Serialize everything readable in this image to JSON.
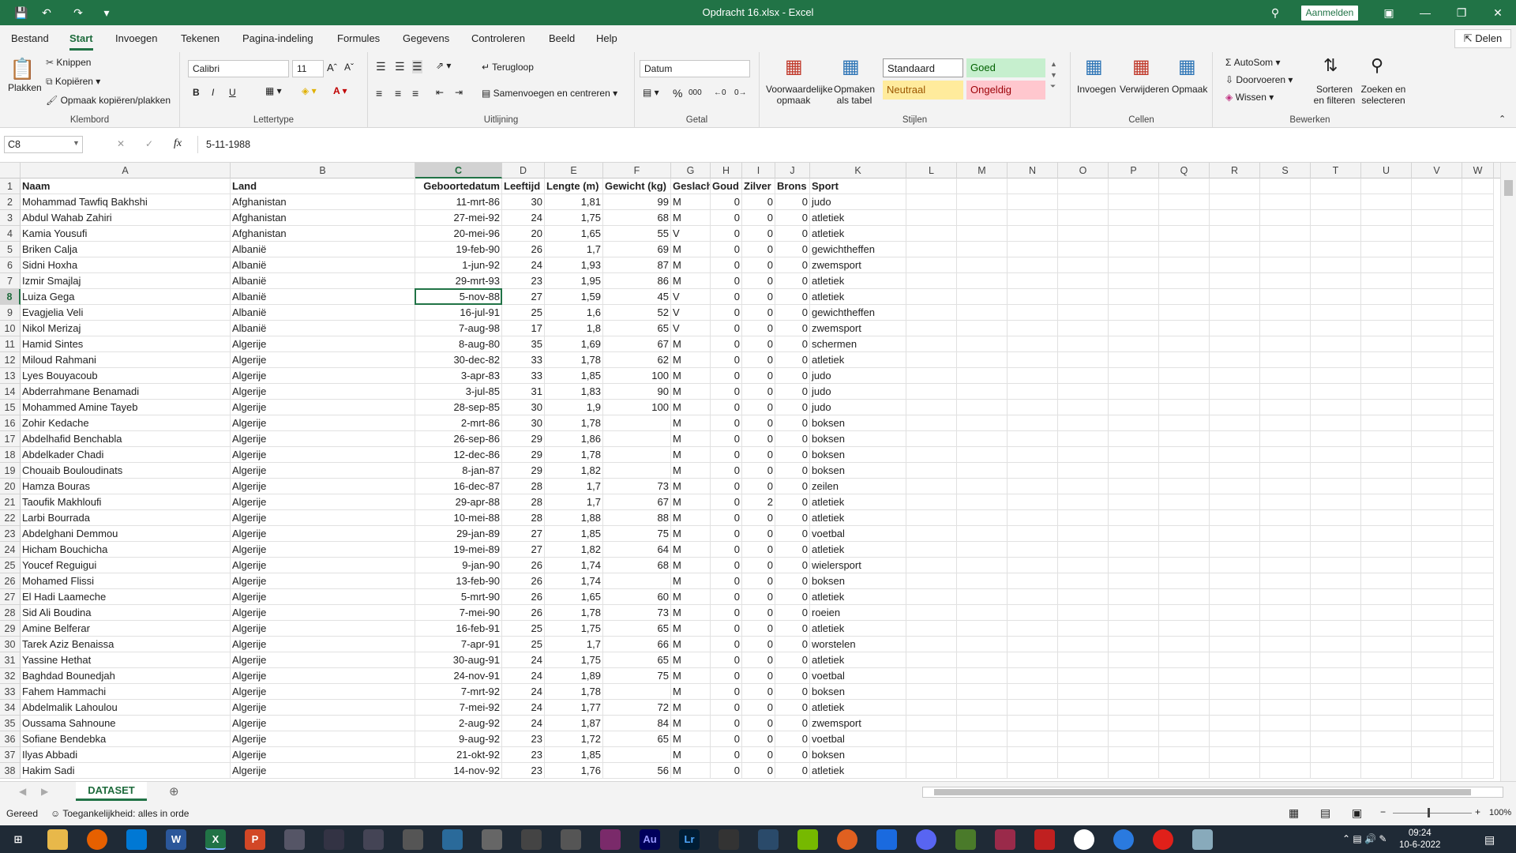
{
  "window": {
    "title": "Opdracht 16.xlsx - Excel",
    "signin": "Aanmelden"
  },
  "ribbon_tabs": [
    "Bestand",
    "Start",
    "Invoegen",
    "Tekenen",
    "Pagina-indeling",
    "Formules",
    "Gegevens",
    "Controleren",
    "Beeld",
    "Help"
  ],
  "active_tab": "Start",
  "share": "Delen",
  "clipboard": {
    "paste": "Plakken",
    "cut": "Knippen",
    "copy": "Kopiëren",
    "format_painter": "Opmaak kopiëren/plakken",
    "label": "Klembord"
  },
  "font": {
    "name": "Calibri",
    "size": "11",
    "label": "Lettertype",
    "bold": "B",
    "italic": "I",
    "underline": "U"
  },
  "alignment": {
    "wrap": "Terugloop",
    "merge": "Samenvoegen en centreren",
    "label": "Uitlijning"
  },
  "number": {
    "format": "Datum",
    "percent": "%",
    "thousands": "000",
    "label": "Getal"
  },
  "styles": {
    "conditional": "Voorwaardelijke opmaak",
    "as_table": "Opmaken als tabel",
    "standaard": "Standaard",
    "goed": "Goed",
    "neutraal": "Neutraal",
    "ongeldig": "Ongeldig",
    "label": "Stijlen"
  },
  "cells": {
    "insert": "Invoegen",
    "delete": "Verwijderen",
    "format": "Opmaak",
    "label": "Cellen"
  },
  "editing": {
    "autosum": "AutoSom",
    "fill": "Doorvoeren",
    "clear": "Wissen",
    "sort": "Sorteren en filteren",
    "find": "Zoeken en selecteren",
    "label": "Bewerken"
  },
  "formula_bar": {
    "name_box": "C8",
    "fx": "fx",
    "content": "5-11-1988"
  },
  "columns": [
    "A",
    "B",
    "C",
    "D",
    "E",
    "F",
    "G",
    "H",
    "I",
    "J",
    "K",
    "L",
    "M",
    "N",
    "O",
    "P",
    "Q",
    "R",
    "S",
    "T",
    "U",
    "V",
    "W"
  ],
  "headers": [
    "Naam",
    "Land",
    "Geboortedatum",
    "Leeftijd",
    "Lengte (m)",
    "Gewicht (kg)",
    "Geslacht",
    "Goud",
    "Zilver",
    "Brons",
    "Sport"
  ],
  "rows": [
    [
      "Mohammad Tawfiq Bakhshi",
      "Afghanistan",
      "11-mrt-86",
      "30",
      "1,81",
      "99",
      "M",
      "0",
      "0",
      "0",
      "judo"
    ],
    [
      "Abdul Wahab Zahiri",
      "Afghanistan",
      "27-mei-92",
      "24",
      "1,75",
      "68",
      "M",
      "0",
      "0",
      "0",
      "atletiek"
    ],
    [
      "Kamia Yousufi",
      "Afghanistan",
      "20-mei-96",
      "20",
      "1,65",
      "55",
      "V",
      "0",
      "0",
      "0",
      "atletiek"
    ],
    [
      "Briken Calja",
      "Albanië",
      "19-feb-90",
      "26",
      "1,7",
      "69",
      "M",
      "0",
      "0",
      "0",
      "gewichtheffen"
    ],
    [
      "Sidni Hoxha",
      "Albanië",
      "1-jun-92",
      "24",
      "1,93",
      "87",
      "M",
      "0",
      "0",
      "0",
      "zwemsport"
    ],
    [
      "Izmir Smajlaj",
      "Albanië",
      "29-mrt-93",
      "23",
      "1,95",
      "86",
      "M",
      "0",
      "0",
      "0",
      "atletiek"
    ],
    [
      "Luiza Gega",
      "Albanië",
      "5-nov-88",
      "27",
      "1,59",
      "45",
      "V",
      "0",
      "0",
      "0",
      "atletiek"
    ],
    [
      "Evagjelia Veli",
      "Albanië",
      "16-jul-91",
      "25",
      "1,6",
      "52",
      "V",
      "0",
      "0",
      "0",
      "gewichtheffen"
    ],
    [
      "Nikol Merizaj",
      "Albanië",
      "7-aug-98",
      "17",
      "1,8",
      "65",
      "V",
      "0",
      "0",
      "0",
      "zwemsport"
    ],
    [
      "Hamid Sintes",
      "Algerije",
      "8-aug-80",
      "35",
      "1,69",
      "67",
      "M",
      "0",
      "0",
      "0",
      "schermen"
    ],
    [
      "Miloud Rahmani",
      "Algerije",
      "30-dec-82",
      "33",
      "1,78",
      "62",
      "M",
      "0",
      "0",
      "0",
      "atletiek"
    ],
    [
      "Lyes Bouyacoub",
      "Algerije",
      "3-apr-83",
      "33",
      "1,85",
      "100",
      "M",
      "0",
      "0",
      "0",
      "judo"
    ],
    [
      "Abderrahmane Benamadi",
      "Algerije",
      "3-jul-85",
      "31",
      "1,83",
      "90",
      "M",
      "0",
      "0",
      "0",
      "judo"
    ],
    [
      "Mohammed Amine Tayeb",
      "Algerije",
      "28-sep-85",
      "30",
      "1,9",
      "100",
      "M",
      "0",
      "0",
      "0",
      "judo"
    ],
    [
      "Zohir Kedache",
      "Algerije",
      "2-mrt-86",
      "30",
      "1,78",
      "",
      "M",
      "0",
      "0",
      "0",
      "boksen"
    ],
    [
      "Abdelhafid Benchabla",
      "Algerije",
      "26-sep-86",
      "29",
      "1,86",
      "",
      "M",
      "0",
      "0",
      "0",
      "boksen"
    ],
    [
      "Abdelkader Chadi",
      "Algerije",
      "12-dec-86",
      "29",
      "1,78",
      "",
      "M",
      "0",
      "0",
      "0",
      "boksen"
    ],
    [
      "Chouaib Bouloudinats",
      "Algerije",
      "8-jan-87",
      "29",
      "1,82",
      "",
      "M",
      "0",
      "0",
      "0",
      "boksen"
    ],
    [
      "Hamza Bouras",
      "Algerije",
      "16-dec-87",
      "28",
      "1,7",
      "73",
      "M",
      "0",
      "0",
      "0",
      "zeilen"
    ],
    [
      "Taoufik Makhloufi",
      "Algerije",
      "29-apr-88",
      "28",
      "1,7",
      "67",
      "M",
      "0",
      "2",
      "0",
      "atletiek"
    ],
    [
      "Larbi Bourrada",
      "Algerije",
      "10-mei-88",
      "28",
      "1,88",
      "88",
      "M",
      "0",
      "0",
      "0",
      "atletiek"
    ],
    [
      "Abdelghani Demmou",
      "Algerije",
      "29-jan-89",
      "27",
      "1,85",
      "75",
      "M",
      "0",
      "0",
      "0",
      "voetbal"
    ],
    [
      "Hicham Bouchicha",
      "Algerije",
      "19-mei-89",
      "27",
      "1,82",
      "64",
      "M",
      "0",
      "0",
      "0",
      "atletiek"
    ],
    [
      "Youcef Reguigui",
      "Algerije",
      "9-jan-90",
      "26",
      "1,74",
      "68",
      "M",
      "0",
      "0",
      "0",
      "wielersport"
    ],
    [
      "Mohamed Flissi",
      "Algerije",
      "13-feb-90",
      "26",
      "1,74",
      "",
      "M",
      "0",
      "0",
      "0",
      "boksen"
    ],
    [
      "El Hadi Laameche",
      "Algerije",
      "5-mrt-90",
      "26",
      "1,65",
      "60",
      "M",
      "0",
      "0",
      "0",
      "atletiek"
    ],
    [
      "Sid Ali Boudina",
      "Algerije",
      "7-mei-90",
      "26",
      "1,78",
      "73",
      "M",
      "0",
      "0",
      "0",
      "roeien"
    ],
    [
      "Amine Belferar",
      "Algerije",
      "16-feb-91",
      "25",
      "1,75",
      "65",
      "M",
      "0",
      "0",
      "0",
      "atletiek"
    ],
    [
      "Tarek Aziz Benaissa",
      "Algerije",
      "7-apr-91",
      "25",
      "1,7",
      "66",
      "M",
      "0",
      "0",
      "0",
      "worstelen"
    ],
    [
      "Yassine Hethat",
      "Algerije",
      "30-aug-91",
      "24",
      "1,75",
      "65",
      "M",
      "0",
      "0",
      "0",
      "atletiek"
    ],
    [
      "Baghdad Bounedjah",
      "Algerije",
      "24-nov-91",
      "24",
      "1,89",
      "75",
      "M",
      "0",
      "0",
      "0",
      "voetbal"
    ],
    [
      "Fahem Hammachi",
      "Algerije",
      "7-mrt-92",
      "24",
      "1,78",
      "",
      "M",
      "0",
      "0",
      "0",
      "boksen"
    ],
    [
      "Abdelmalik Lahoulou",
      "Algerije",
      "7-mei-92",
      "24",
      "1,77",
      "72",
      "M",
      "0",
      "0",
      "0",
      "atletiek"
    ],
    [
      "Oussama Sahnoune",
      "Algerije",
      "2-aug-92",
      "24",
      "1,87",
      "84",
      "M",
      "0",
      "0",
      "0",
      "zwemsport"
    ],
    [
      "Sofiane Bendebka",
      "Algerije",
      "9-aug-92",
      "23",
      "1,72",
      "65",
      "M",
      "0",
      "0",
      "0",
      "voetbal"
    ],
    [
      "Ilyas Abbadi",
      "Algerije",
      "21-okt-92",
      "23",
      "1,85",
      "",
      "M",
      "0",
      "0",
      "0",
      "boksen"
    ],
    [
      "Hakim Sadi",
      "Algerije",
      "14-nov-92",
      "23",
      "1,76",
      "56",
      "M",
      "0",
      "0",
      "0",
      "atletiek"
    ]
  ],
  "selected": {
    "row": 8,
    "col": "C"
  },
  "sheet_tab": "DATASET",
  "status": {
    "ready": "Gereed",
    "accessibility": "Toegankelijkheid: alles in orde",
    "zoom": "100%"
  },
  "taskbar": {
    "time": "09:24",
    "date": "10-6-2022"
  },
  "colors": {
    "excel_green": "#217346",
    "good_bg": "#c6efce",
    "good_fg": "#006100",
    "neutral_bg": "#ffeb9c",
    "neutral_fg": "#9c5700",
    "bad_bg": "#ffc7ce",
    "bad_fg": "#9c0006"
  }
}
